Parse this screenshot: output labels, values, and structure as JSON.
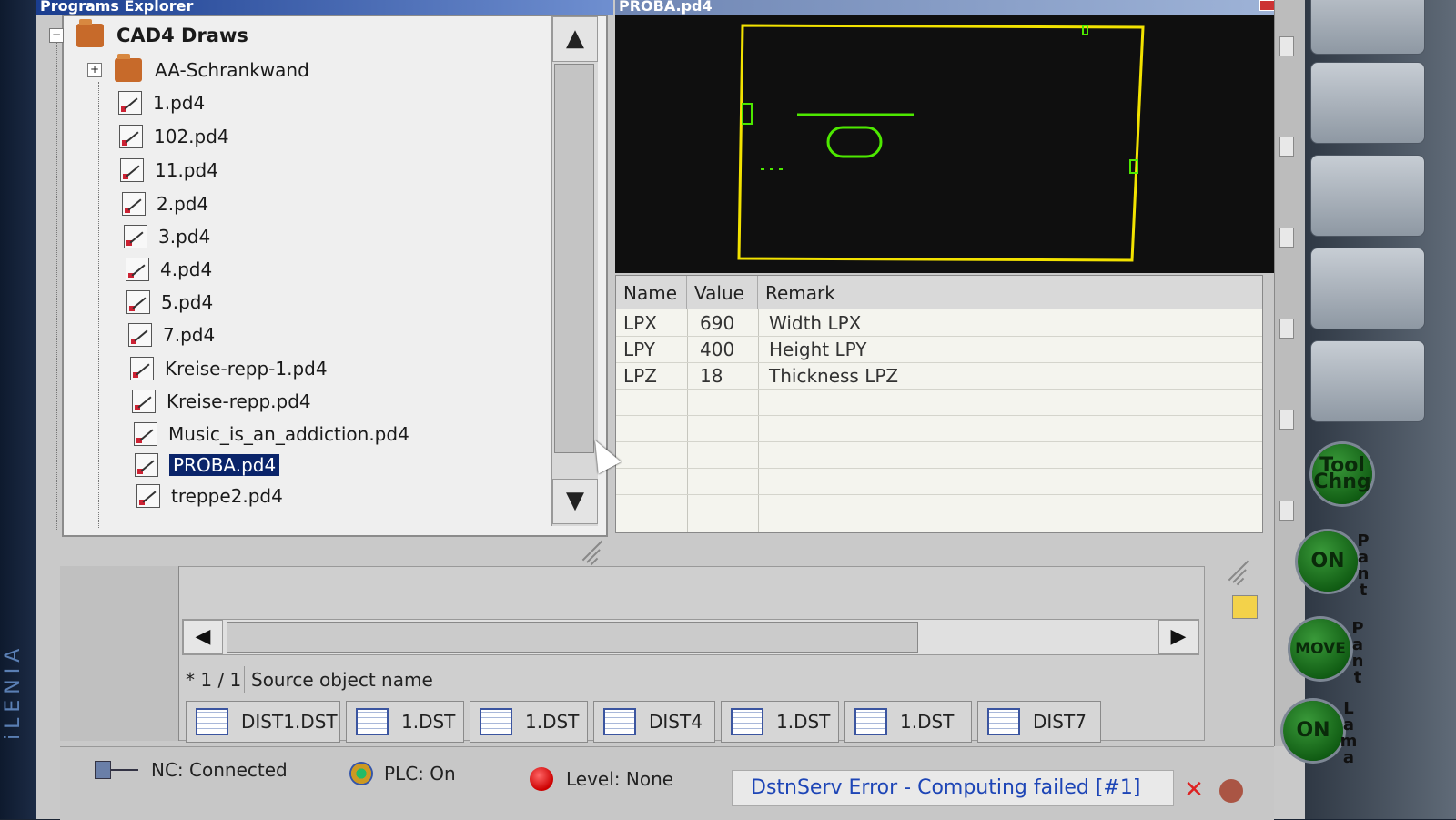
{
  "brand": {
    "text": "iLENIA"
  },
  "explorer": {
    "title": "Programs Explorer",
    "root": {
      "label": "CAD4 Draws",
      "expander": "−"
    },
    "folder": {
      "label": "AA-Schrankwand",
      "expander": "+"
    },
    "files": [
      {
        "label": "1.pd4"
      },
      {
        "label": "102.pd4"
      },
      {
        "label": "11.pd4"
      },
      {
        "label": "2.pd4"
      },
      {
        "label": "3.pd4"
      },
      {
        "label": "4.pd4"
      },
      {
        "label": "5.pd4"
      },
      {
        "label": "7.pd4"
      },
      {
        "label": "Kreise-repp-1.pd4"
      },
      {
        "label": "Kreise-repp.pd4"
      },
      {
        "label": "Music_is_an_addiction.pd4"
      },
      {
        "label": "PROBA.pd4",
        "selected": true
      },
      {
        "label": "treppe2.pd4"
      }
    ],
    "scroll_up": "▲",
    "scroll_down": "▼"
  },
  "preview": {
    "title": "PROBA.pd4",
    "outline_color": "#f2e200",
    "shape_color": "#4de800"
  },
  "params": {
    "headers": [
      "Name",
      "Value",
      "Remark"
    ],
    "rows": [
      {
        "name": "LPX",
        "value": "690",
        "remark": "Width LPX"
      },
      {
        "name": "LPY",
        "value": "400",
        "remark": "Height LPY"
      },
      {
        "name": "LPZ",
        "value": "18",
        "remark": "Thickness LPZ"
      }
    ]
  },
  "lower": {
    "scroll_left": "◀",
    "scroll_right": "▶",
    "page": "* 1 / 1",
    "source_label": "Source object name"
  },
  "tabs": [
    {
      "label": "DIST1.DST"
    },
    {
      "label": "1.DST"
    },
    {
      "label": "1.DST"
    },
    {
      "label": "DIST4"
    },
    {
      "label": "1.DST"
    },
    {
      "label": "1.DST"
    },
    {
      "label": "DIST7"
    }
  ],
  "status": {
    "nc": "NC: Connected",
    "plc": "PLC: On",
    "level": "Level: None",
    "error": "DstnServ Error - Computing failed  [#1]",
    "error_close": "✕"
  },
  "right_panel": {
    "tool_change": "Tool Chng",
    "on_1": "ON",
    "side_1": "P\na\nn\nt",
    "move": "MOVE",
    "side_2": "P\na\nn\nt",
    "on_2": "ON",
    "side_3": "L\na\nm\na"
  },
  "colors": {
    "selection": "#0a246a",
    "error_text": "#1d45b6",
    "button_green": "#1a6e1d"
  }
}
